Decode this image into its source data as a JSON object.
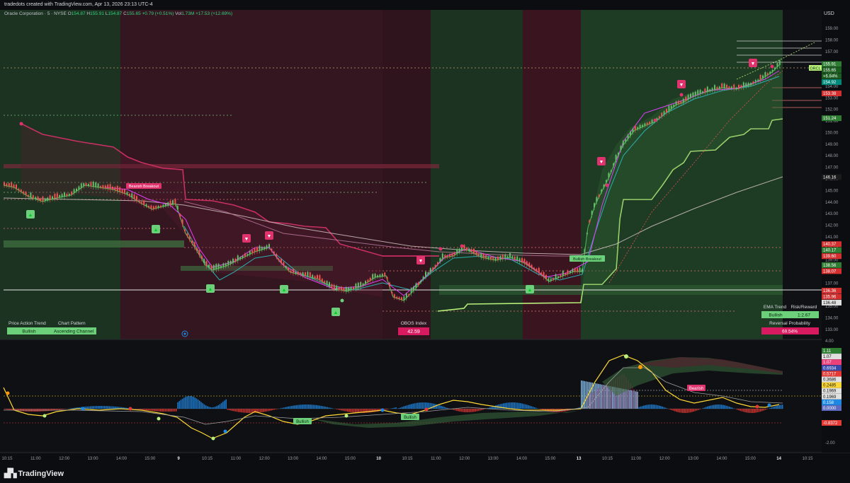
{
  "header": {
    "caption": "tradedots created with TradingView.com, Apr 13, 2026 23:13 UTC-4"
  },
  "legend": {
    "symbol": "Oracle Corporation · 5 · NYSE",
    "open_label": "O",
    "open": "154.87",
    "high_label": "H",
    "high": "155.91",
    "low_label": "L",
    "low": "154.87",
    "close_label": "C",
    "close": "155.65",
    "change": "+0.79 (+0.51%)",
    "vol_label": "Vol",
    "volume": "1.73M",
    "vol_change": "+17.53 (+12.69%)"
  },
  "currency": "USD",
  "price_axis": {
    "ticks": [
      "159.00",
      "158.00",
      "157.00",
      "156.00",
      "155.00",
      "154.00",
      "153.00",
      "152.00",
      "151.00",
      "150.00",
      "149.00",
      "148.00",
      "147.00",
      "146.00",
      "145.00",
      "144.00",
      "143.00",
      "142.00",
      "141.00",
      "140.00",
      "139.00",
      "138.00",
      "137.00",
      "136.00",
      "135.00",
      "134.00",
      "133.00"
    ],
    "tags": [
      {
        "text": "155.91",
        "color": "#2e7d32"
      },
      {
        "text": "155.65",
        "color": "#1b5e20"
      },
      {
        "text": "+6.84%",
        "color": "#1b5e20"
      },
      {
        "text": "154.92",
        "color": "#00897b"
      },
      {
        "text": "153.38",
        "color": "#d32f2f"
      },
      {
        "text": "151.24",
        "color": "#2e7d32"
      },
      {
        "text": "146.16",
        "color": "#1b1b1b"
      },
      {
        "text": "140.37",
        "color": "#d32f2f"
      },
      {
        "text": "140.17",
        "color": "#2e7d32"
      },
      {
        "text": "139.60",
        "color": "#d32f2f"
      },
      {
        "text": "138.56",
        "color": "#2e7d32"
      },
      {
        "text": "138.07",
        "color": "#d32f2f"
      },
      {
        "text": "136.36",
        "color": "#d32f2f"
      },
      {
        "text": "135.96",
        "color": "#d32f2f"
      },
      {
        "text": "136.48",
        "color": "#e0e0e0"
      }
    ],
    "symbol_tag": "ORCL"
  },
  "osc_axis": {
    "ticks": [
      "4.00",
      "-2.00"
    ],
    "tags": [
      {
        "text": "1.11",
        "color": "#2e7d32"
      },
      {
        "text": "1.07",
        "color": "#e0e0e0"
      },
      {
        "text": "1.07",
        "color": "#ec407a"
      },
      {
        "text": "0.6934",
        "color": "#3949ab"
      },
      {
        "text": "0.5717",
        "color": "#e53935"
      },
      {
        "text": "0.3686",
        "color": "#e0e0e0"
      },
      {
        "text": "0.2485",
        "color": "#fdd835"
      },
      {
        "text": "0.1969",
        "color": "#e0e0e0"
      },
      {
        "text": "0.1969",
        "color": "#e0e0e0"
      },
      {
        "text": "0.158",
        "color": "#1e88e5"
      },
      {
        "text": "0.0000",
        "color": "#5c6bc0"
      },
      {
        "text": "-0.8372",
        "color": "#e53935"
      }
    ]
  },
  "time_axis": [
    "10:15",
    "11:00",
    "12:00",
    "13:00",
    "14:00",
    "15:00",
    "9",
    "10:15",
    "11:00",
    "12:00",
    "13:00",
    "14:00",
    "15:00",
    "10",
    "10:15",
    "11:00",
    "12:00",
    "13:00",
    "14:00",
    "15:00",
    "13",
    "10:15",
    "11:00",
    "12:00",
    "13:00",
    "14:00",
    "15:00",
    "14",
    "10:15"
  ],
  "chart_labels": {
    "bearish_breakout": "Bearish Breakout",
    "bullish_breakout": "Bullish Breakout",
    "osc_bullish_1": "Bullish",
    "osc_bullish_2": "Bullish",
    "osc_bearish": "Bearish"
  },
  "info_panels": {
    "price_action_trend_label": "Price Action Trend",
    "price_action_trend_value": "Bullish",
    "chart_pattern_label": "Chart Pattern",
    "chart_pattern_value": "Ascending Channel",
    "obos_label": "OBOS Index",
    "obos_value": "42.59",
    "ema_trend_label": "EMA Trend",
    "ema_trend_value": "Bullish",
    "risk_reward_label": "Risk/Reward",
    "risk_reward_value": "1:2.67",
    "reversal_label": "Reversal Probability",
    "reversal_value": "69.54%"
  },
  "brand": "TradingView",
  "colors": {
    "bull": "#4caf50",
    "bear": "#e91e63",
    "bull_zone": "#1c3a22",
    "bear_zone": "#3a1520"
  }
}
